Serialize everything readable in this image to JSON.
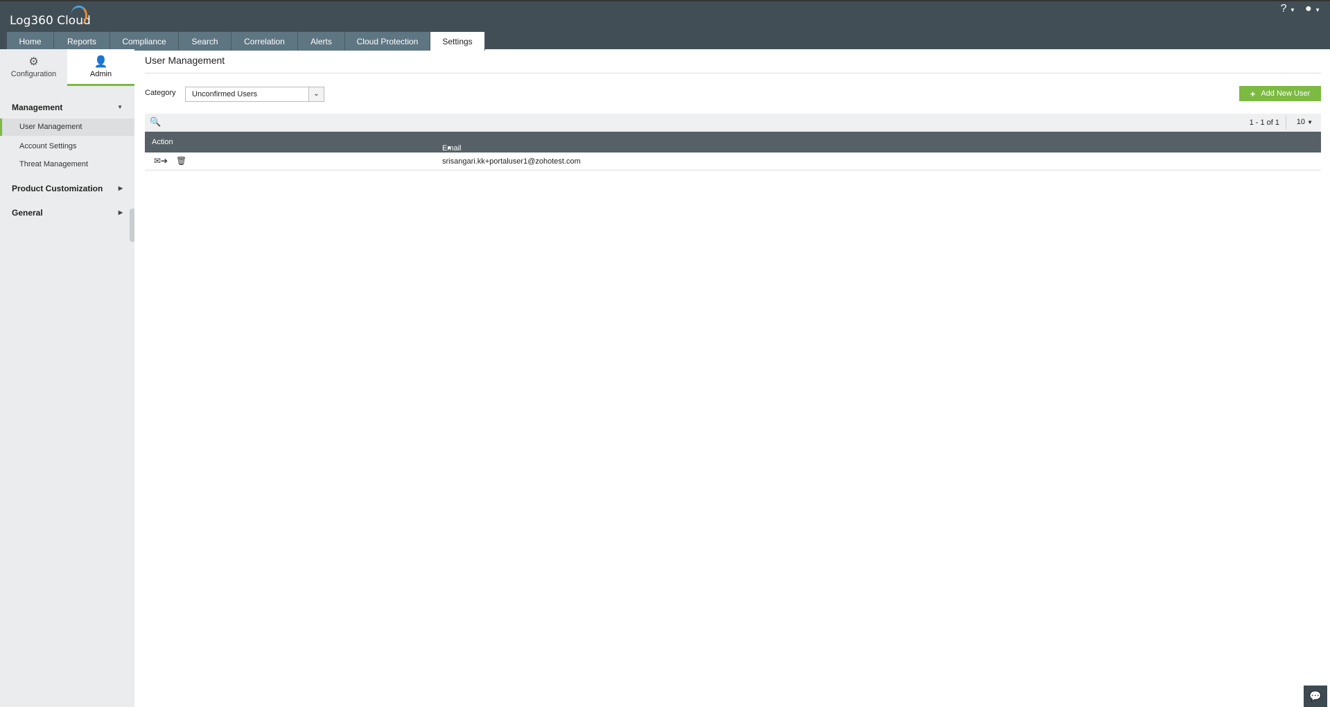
{
  "app": {
    "logo": "Log360 Cloud"
  },
  "tabs": [
    "Home",
    "Reports",
    "Compliance",
    "Search",
    "Correlation",
    "Alerts",
    "Cloud Protection",
    "Settings"
  ],
  "header_icons": {
    "help": "?",
    "user": "user-icon"
  },
  "side_tabs": {
    "configuration": "Configuration",
    "admin": "Admin"
  },
  "sidebar": {
    "management": "Management",
    "items": [
      "User Management",
      "Account Settings",
      "Threat Management"
    ],
    "product_customization": "Product Customization",
    "general": "General"
  },
  "main": {
    "title": "User Management",
    "category_label": "Category",
    "category_value": "Unconfirmed Users",
    "add_button": "Add New User",
    "pagination": "1 - 1 of 1",
    "per_page": "10",
    "columns": {
      "action": "Action",
      "email": "Email"
    },
    "rows": [
      {
        "email": "srisangari.kk+portaluser1@zohotest.com"
      }
    ]
  },
  "colors": {
    "accent": "#7cba42",
    "header": "#424e56"
  }
}
